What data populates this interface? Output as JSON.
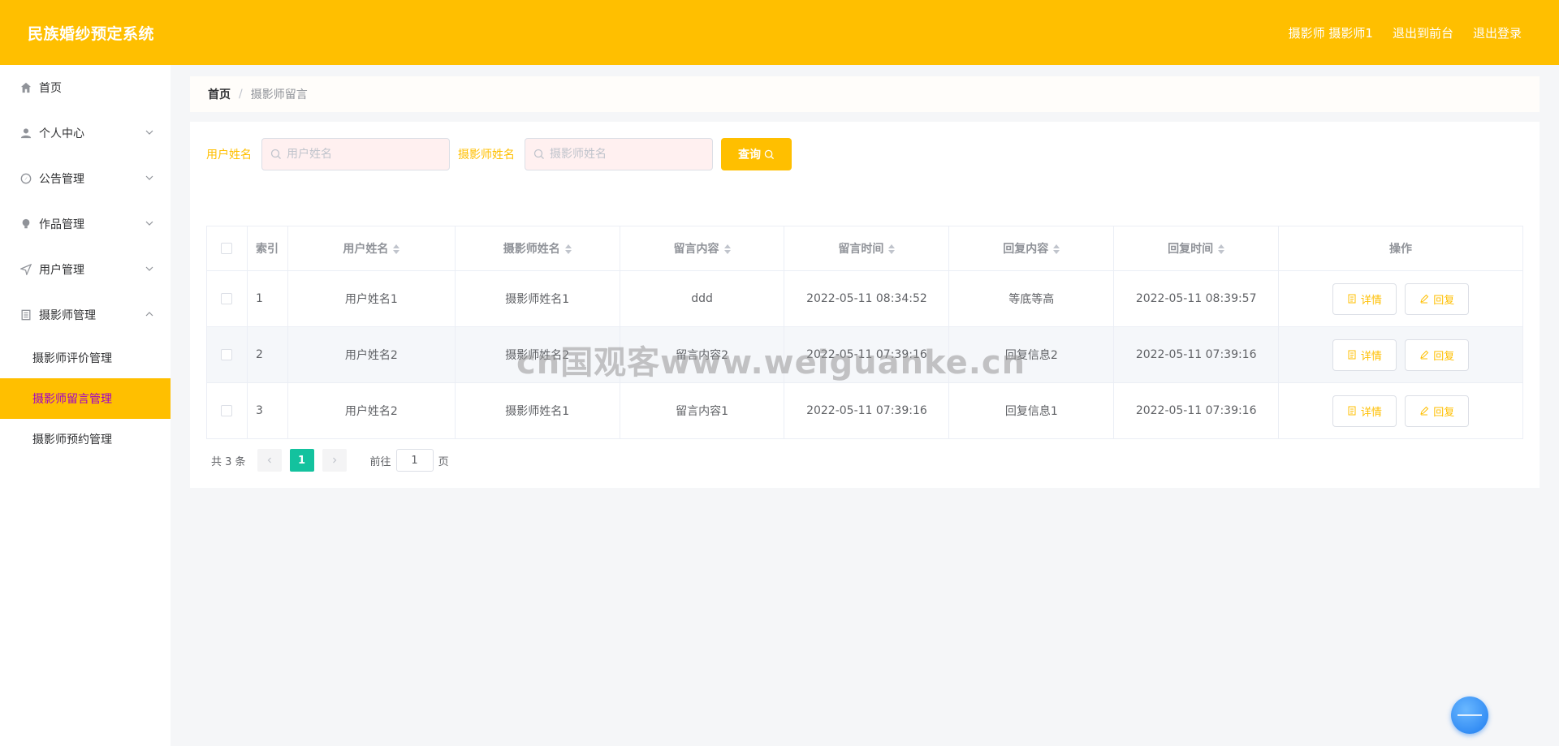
{
  "header": {
    "title": "民族婚纱预定系统",
    "user": "摄影师 摄影师1",
    "to_front": "退出到前台",
    "logout": "退出登录",
    "accent": "#ffbf00"
  },
  "sidebar": {
    "items": [
      {
        "label": "首页",
        "icon": "home-icon"
      },
      {
        "label": "个人中心",
        "icon": "user-icon"
      },
      {
        "label": "公告管理",
        "icon": "compass-icon"
      },
      {
        "label": "作品管理",
        "icon": "bulb-icon"
      },
      {
        "label": "用户管理",
        "icon": "send-icon"
      },
      {
        "label": "摄影师管理",
        "icon": "document-icon"
      }
    ],
    "sub_items": [
      {
        "label": "摄影师评价管理"
      },
      {
        "label": "摄影师留言管理"
      },
      {
        "label": "摄影师预约管理"
      }
    ]
  },
  "breadcrumb": {
    "home": "首页",
    "separator": "/",
    "current": "摄影师留言"
  },
  "search": {
    "user_label": "用户姓名",
    "user_placeholder": "用户姓名",
    "photographer_label": "摄影师姓名",
    "photographer_placeholder": "摄影师姓名",
    "query_label": "查询"
  },
  "table": {
    "headers": [
      "索引",
      "用户姓名",
      "摄影师姓名",
      "留言内容",
      "留言时间",
      "回复内容",
      "回复时间",
      "操作"
    ],
    "rows": [
      {
        "idx": "1",
        "user": "用户姓名1",
        "photographer": "摄影师姓名1",
        "content": "ddd",
        "msg_time": "2022-05-11 08:34:52",
        "reply": "等底等高",
        "reply_time": "2022-05-11 08:39:57"
      },
      {
        "idx": "2",
        "user": "用户姓名2",
        "photographer": "摄影师姓名2",
        "content": "留言内容2",
        "msg_time": "2022-05-11 07:39:16",
        "reply": "回复信息2",
        "reply_time": "2022-05-11 07:39:16"
      },
      {
        "idx": "3",
        "user": "用户姓名2",
        "photographer": "摄影师姓名1",
        "content": "留言内容1",
        "msg_time": "2022-05-11 07:39:16",
        "reply": "回复信息1",
        "reply_time": "2022-05-11 07:39:16"
      }
    ],
    "detail_label": "详情",
    "reply_label": "回复"
  },
  "pagination": {
    "total": "共 3 条",
    "current": "1",
    "goto_label": "前往",
    "goto_value": "1",
    "page_unit": "页"
  },
  "watermark": "cn国观客www.weiguanke.cn"
}
